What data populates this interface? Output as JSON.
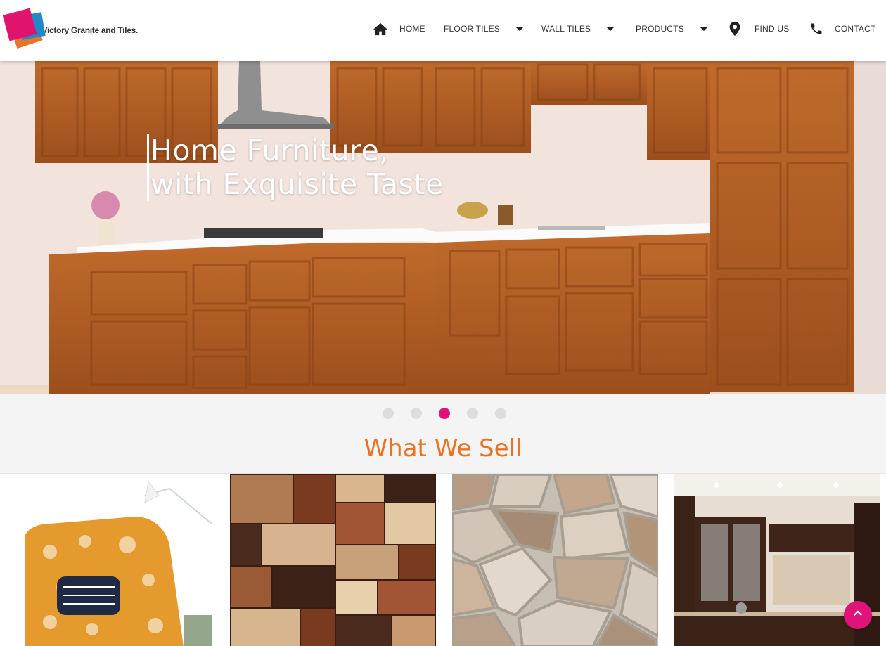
{
  "brand": {
    "name": "Victory Granite and Tiles.",
    "colors": {
      "pink": "#e0137a",
      "blue": "#1e88c8",
      "orange": "#e8742a"
    }
  },
  "nav": {
    "home": {
      "label": "HOME",
      "icon": "home-icon"
    },
    "floor_tiles": {
      "label": "FLOOR TILES",
      "icon": "caret-down-icon"
    },
    "wall_tiles": {
      "label": "WALL TILES",
      "icon": "caret-down-icon"
    },
    "products": {
      "label": "PRODUCTS",
      "icon": "caret-down-icon"
    },
    "find_us": {
      "label": "FIND US",
      "icon": "location-pin-icon"
    },
    "contact": {
      "label": "CONTACT",
      "icon": "phone-icon"
    }
  },
  "hero": {
    "line1": "Home Furniture,",
    "line2": "with Exquisite Taste",
    "slide_count": 5,
    "active_slide": 3
  },
  "section": {
    "title": "What We Sell",
    "accent": "#e97322"
  },
  "products": [
    {
      "name": "armchair"
    },
    {
      "name": "marble-tiles"
    },
    {
      "name": "stone-tiles"
    },
    {
      "name": "modular-kitchen"
    }
  ],
  "scroll_top": {
    "icon": "chevron-up-icon"
  }
}
